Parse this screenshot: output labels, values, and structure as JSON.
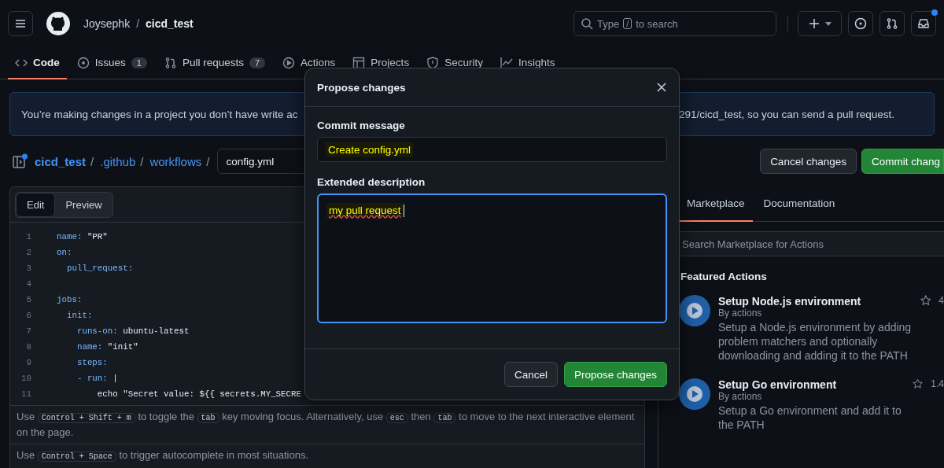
{
  "header": {
    "owner": "Joysephk",
    "separator": "/",
    "repo": "cicd_test",
    "search": {
      "before": "Type",
      "key": "/",
      "after": "to search"
    },
    "notifications_unread": true
  },
  "nav_tabs": [
    {
      "label": "Code",
      "selected": true
    },
    {
      "label": "Issues",
      "count": "1",
      "selected": false
    },
    {
      "label": "Pull requests",
      "count": "7",
      "selected": false
    },
    {
      "label": "Actions",
      "selected": false
    },
    {
      "label": "Projects",
      "selected": false
    },
    {
      "label": "Security",
      "selected": false
    },
    {
      "label": "Insights",
      "selected": false
    }
  ],
  "banner": {
    "text_left": "You’re making changes in a project you don’t have write ac",
    "text_right": "291/cicd_test, so you can send a pull request."
  },
  "breadcrumb": {
    "parts": [
      {
        "label": "cicd_test",
        "kind": "link"
      },
      {
        "label": "/",
        "kind": "sep"
      },
      {
        "label": ".github",
        "kind": "link"
      },
      {
        "label": "/",
        "kind": "sep"
      },
      {
        "label": "workflows",
        "kind": "link"
      },
      {
        "label": "/",
        "kind": "sep"
      }
    ],
    "filename": "config.yml"
  },
  "actions": {
    "cancel": "Cancel changes",
    "commit": "Commit chang"
  },
  "editor": {
    "tabs": [
      {
        "label": "Edit",
        "selected": true
      },
      {
        "label": "Preview",
        "selected": false
      }
    ],
    "lines": [
      {
        "number": "1",
        "key": "name:",
        "value": " \"PR\""
      },
      {
        "number": "2",
        "key": "on:"
      },
      {
        "number": "3",
        "key": "  pull_request:"
      },
      {
        "number": "4"
      },
      {
        "number": "5",
        "key": "jobs:"
      },
      {
        "number": "6",
        "key": "  init:"
      },
      {
        "number": "7",
        "key": "    runs-on:",
        "value": " ubuntu-latest"
      },
      {
        "number": "8",
        "key": "    name:",
        "value": " \"init\""
      },
      {
        "number": "9",
        "key": "    steps:"
      },
      {
        "number": "10",
        "key": "    - run:",
        "value": " |"
      },
      {
        "number": "11",
        "value": "        echo \"Secret value: ${{ secrets.MY_SECRE"
      }
    ],
    "hints": [
      [
        {
          "kind": "text",
          "text": "Use"
        },
        {
          "kind": "key",
          "text": "Control + Shift + m"
        },
        {
          "kind": "text",
          "text": "to toggle the"
        },
        {
          "kind": "key",
          "text": "tab"
        },
        {
          "kind": "text",
          "text": "key moving focus. Alternatively, use"
        },
        {
          "kind": "key",
          "text": "esc"
        },
        {
          "kind": "text",
          "text": "then"
        },
        {
          "kind": "key",
          "text": "tab"
        },
        {
          "kind": "text",
          "text": "to move to the next interactive element"
        },
        {
          "kind": "text",
          "text": "on the page."
        }
      ],
      [
        {
          "kind": "text",
          "text": "Use"
        },
        {
          "kind": "key",
          "text": "Control + Space"
        },
        {
          "kind": "text",
          "text": "to trigger autocomplete in most situations."
        }
      ]
    ]
  },
  "side_panel": {
    "tabs": [
      {
        "label": "Marketplace",
        "selected": true
      },
      {
        "label": "Documentation",
        "selected": false
      }
    ],
    "search": {
      "placeholder": "Search Marketplace for Actions"
    },
    "heading": "Featured Actions",
    "items": [
      {
        "title": "Setup Node.js environment",
        "author": "By actions",
        "description": "Setup a Node.js environment by adding problem matchers and optionally downloading and adding it to the PATH",
        "stars_count": "4"
      },
      {
        "title": "Setup Go environment",
        "author": "By actions",
        "description": "Setup a Go environment and add it to the PATH",
        "stars_count": "1.4"
      }
    ]
  },
  "dialog": {
    "title": "Propose changes",
    "commit_label": "Commit message",
    "commit_value": "Create config.yml",
    "description_label": "Extended description",
    "description_value": "my pull request",
    "cancel": "Cancel",
    "submit": "Propose changes"
  }
}
